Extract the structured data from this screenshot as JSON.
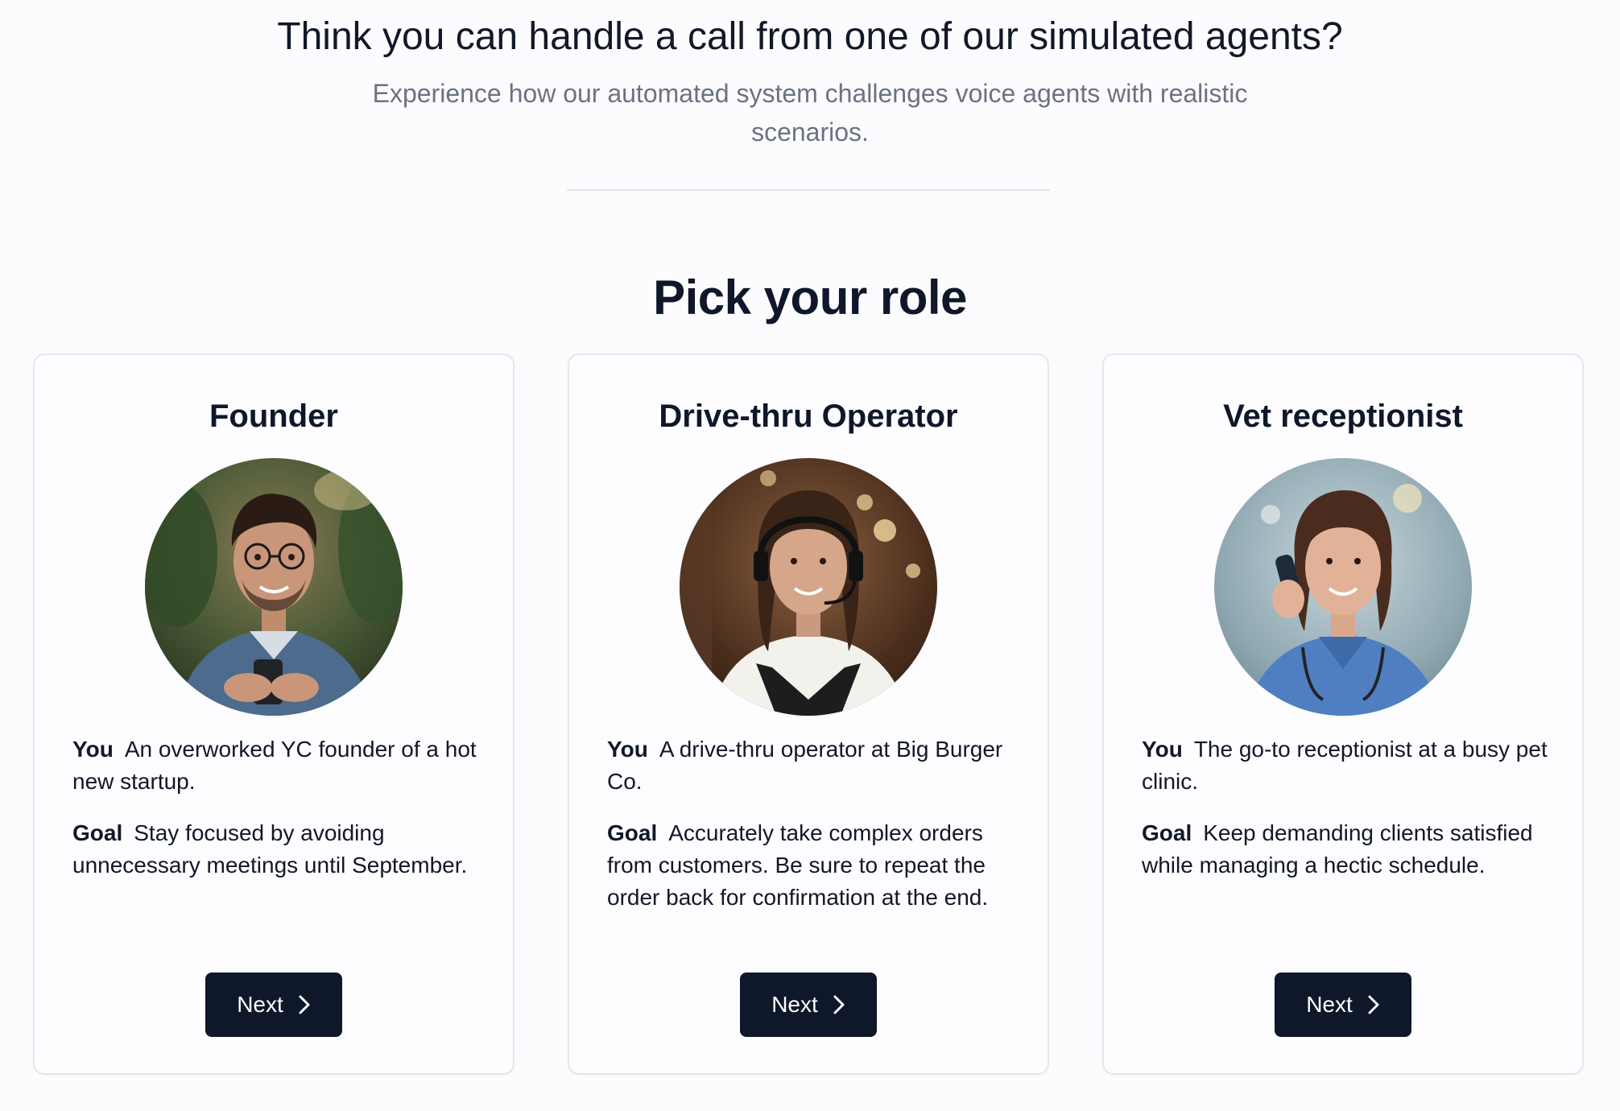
{
  "header": {
    "headline": "Think you can handle a call from one of our simulated agents?",
    "subheadline": "Experience how our automated system challenges voice agents with realistic scenarios."
  },
  "section": {
    "title": "Pick your role"
  },
  "labels": {
    "you": "You",
    "goal": "Goal"
  },
  "icons": {
    "next": "chevron-right-icon"
  },
  "roles": [
    {
      "title": "Founder",
      "avatar": "founder-avatar",
      "you": "An overworked YC founder of a hot new startup.",
      "goal": "Stay focused by avoiding unnecessary meetings until September.",
      "button_label": "Next"
    },
    {
      "title": "Drive-thru Operator",
      "avatar": "drive-thru-operator-avatar",
      "you": "A drive-thru operator at Big Burger Co.",
      "goal": "Accurately take complex orders from customers. Be sure to repeat the order back for confirmation at the end.",
      "button_label": "Next"
    },
    {
      "title": "Vet receptionist",
      "avatar": "vet-receptionist-avatar",
      "you": "The go-to receptionist at a busy pet clinic.",
      "goal": "Keep demanding clients satisfied while managing a hectic schedule.",
      "button_label": "Next"
    }
  ],
  "colors": {
    "background": "#fcfcfe",
    "text_primary": "#0f172a",
    "text_muted": "#6b7280",
    "button_bg": "#0f172a",
    "button_text": "#ffffff",
    "border": "#e5e7eb"
  }
}
